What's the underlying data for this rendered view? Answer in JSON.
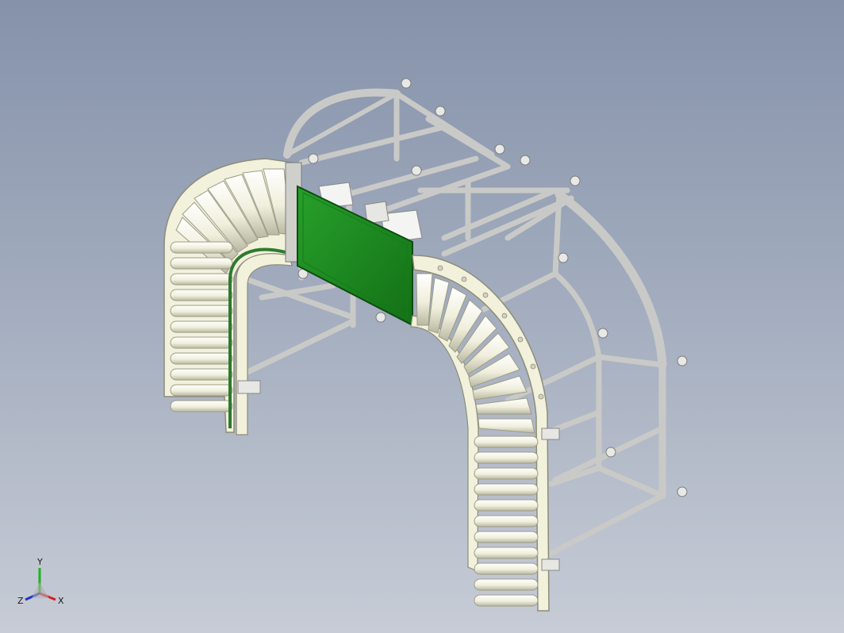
{
  "viewport": {
    "background_top": "#8592aa",
    "background_bottom": "#c7ccd6"
  },
  "model": {
    "icon": "roller-conveyor-assembly-icon",
    "frame_color": "#d9d9d6",
    "rail_color": "#f2f1dc",
    "roller_color": "#f4f3e4",
    "panel_color": "#1f8a22"
  },
  "triad": {
    "x_label": "X",
    "y_label": "Y",
    "z_label": "Z",
    "x_color": "#d81e1e",
    "y_color": "#1fb21f",
    "z_color": "#2233cc"
  }
}
